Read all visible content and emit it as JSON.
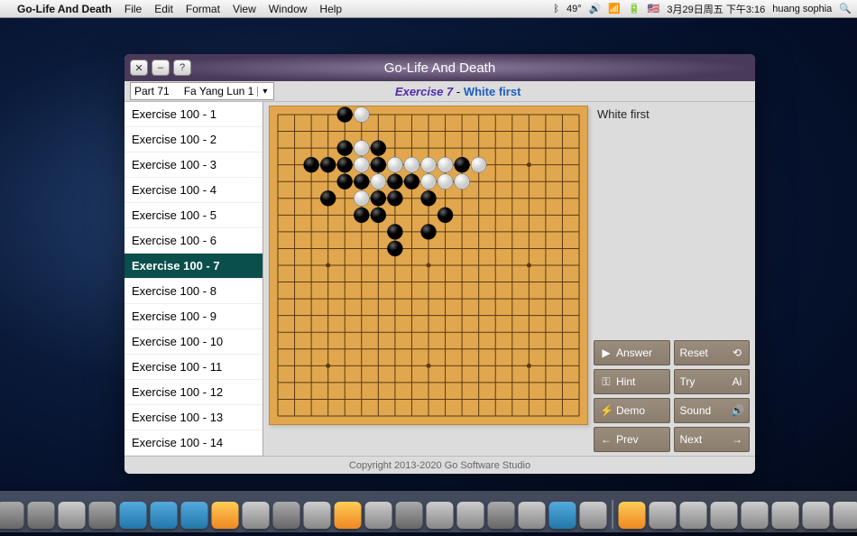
{
  "menubar": {
    "app": "Go-Life And Death",
    "items": [
      "File",
      "Edit",
      "Format",
      "View",
      "Window",
      "Help"
    ],
    "right": {
      "temp": "49°",
      "date": "3月29日周五 下午3:16",
      "user": "huang sophia"
    }
  },
  "window": {
    "title": "Go-Life And Death",
    "selector": {
      "part": "Part 71",
      "name": "Fa Yang Lun 1"
    },
    "headline": {
      "exercise": "Exercise 7",
      "dash": " - ",
      "who": "White first"
    },
    "hint": "White first",
    "footer": "Copyright 2013-2020 Go Software Studio"
  },
  "exercises": [
    "Exercise  100 - 1",
    "Exercise  100 - 2",
    "Exercise  100 - 3",
    "Exercise  100 - 4",
    "Exercise  100 - 5",
    "Exercise  100 - 6",
    "Exercise  100 - 7",
    "Exercise  100 - 8",
    "Exercise  100 - 9",
    "Exercise  100 - 10",
    "Exercise  100 - 11",
    "Exercise  100 - 12",
    "Exercise  100 - 13",
    "Exercise  100 - 14"
  ],
  "selected_index": 6,
  "buttons": {
    "answer": "Answer",
    "reset": "Reset",
    "hint": "Hint",
    "try": "Try",
    "demo": "Demo",
    "sound": "Sound",
    "prev": "Prev",
    "next": "Next"
  },
  "board": {
    "size": 19,
    "stones": {
      "black": [
        [
          5,
          1
        ],
        [
          5,
          3
        ],
        [
          7,
          3
        ],
        [
          3,
          4
        ],
        [
          4,
          4
        ],
        [
          5,
          4
        ],
        [
          7,
          4
        ],
        [
          12,
          4
        ],
        [
          5,
          5
        ],
        [
          6,
          5
        ],
        [
          8,
          5
        ],
        [
          9,
          5
        ],
        [
          4,
          6
        ],
        [
          7,
          6
        ],
        [
          8,
          6
        ],
        [
          10,
          6
        ],
        [
          6,
          7
        ],
        [
          7,
          7
        ],
        [
          11,
          7
        ],
        [
          8,
          8
        ],
        [
          10,
          8
        ],
        [
          8,
          9
        ]
      ],
      "white": [
        [
          6,
          1
        ],
        [
          6,
          3
        ],
        [
          6,
          4
        ],
        [
          8,
          4
        ],
        [
          9,
          4
        ],
        [
          10,
          4
        ],
        [
          11,
          4
        ],
        [
          13,
          4
        ],
        [
          7,
          5
        ],
        [
          10,
          5
        ],
        [
          11,
          5
        ],
        [
          12,
          5
        ],
        [
          6,
          6
        ]
      ]
    },
    "hoshi": [
      [
        4,
        4
      ],
      [
        10,
        4
      ],
      [
        16,
        4
      ],
      [
        4,
        10
      ],
      [
        10,
        10
      ],
      [
        16,
        10
      ],
      [
        4,
        16
      ],
      [
        10,
        16
      ],
      [
        16,
        16
      ]
    ]
  }
}
